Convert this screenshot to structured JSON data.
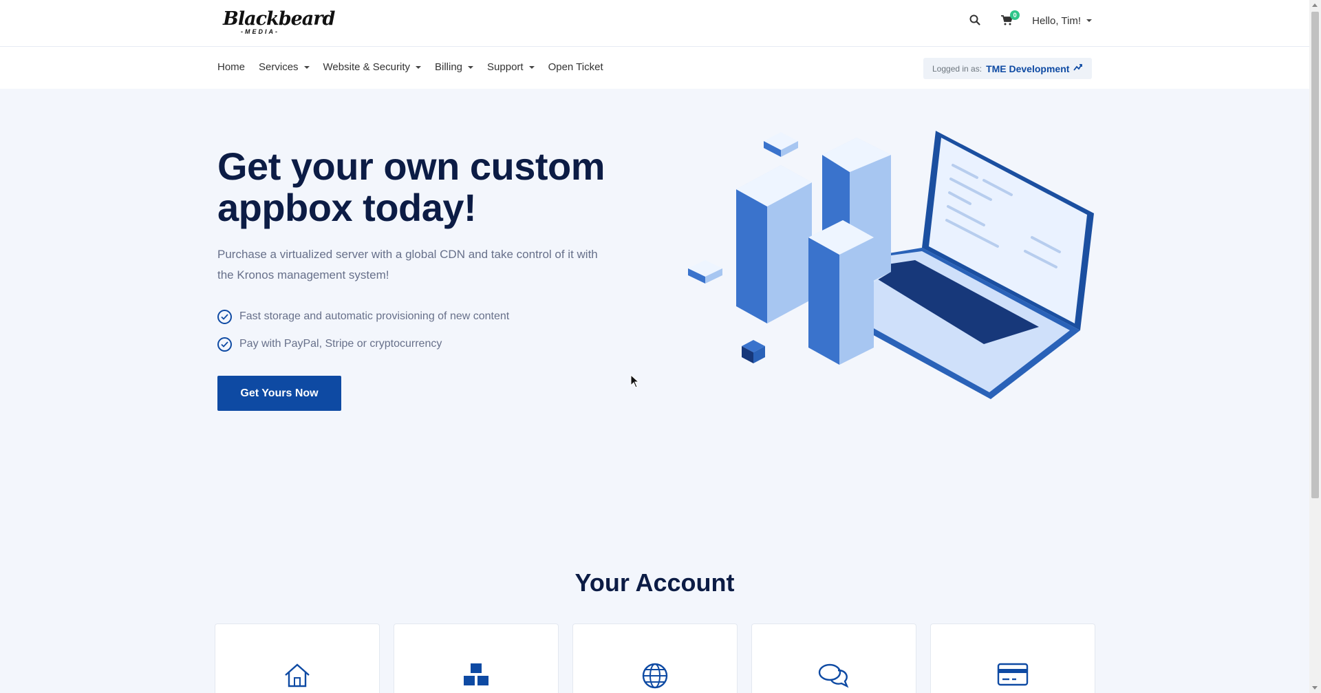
{
  "brand": {
    "logo_main": "Blackbeard",
    "logo_sub": "-MEDIA-"
  },
  "header": {
    "cart_count": "0",
    "user_greeting": "Hello, Tim!"
  },
  "nav": {
    "items": [
      {
        "label": "Home",
        "dropdown": false
      },
      {
        "label": "Services",
        "dropdown": true
      },
      {
        "label": "Website & Security",
        "dropdown": true
      },
      {
        "label": "Billing",
        "dropdown": true
      },
      {
        "label": "Support",
        "dropdown": true
      },
      {
        "label": "Open Ticket",
        "dropdown": false
      }
    ],
    "logged_in_label": "Logged in as:",
    "logged_in_name": "TME Development"
  },
  "hero": {
    "title": "Get your own custom appbox today!",
    "description": "Purchase a virtualized server with a global CDN and take control of it with the Kronos management system!",
    "features": [
      "Fast storage and automatic provisioning of new content",
      "Pay with PayPal, Stripe or cryptocurrency"
    ],
    "cta_label": "Get Yours Now"
  },
  "account": {
    "title": "Your Account",
    "cards": [
      {
        "icon": "home-icon"
      },
      {
        "icon": "cubes-icon"
      },
      {
        "icon": "globe-icon"
      },
      {
        "icon": "comments-icon"
      },
      {
        "icon": "credit-card-icon"
      }
    ]
  },
  "colors": {
    "primary": "#0e4aa3",
    "heading": "#0c1c45",
    "background": "#f3f6fc",
    "badge": "#2fc68b"
  }
}
